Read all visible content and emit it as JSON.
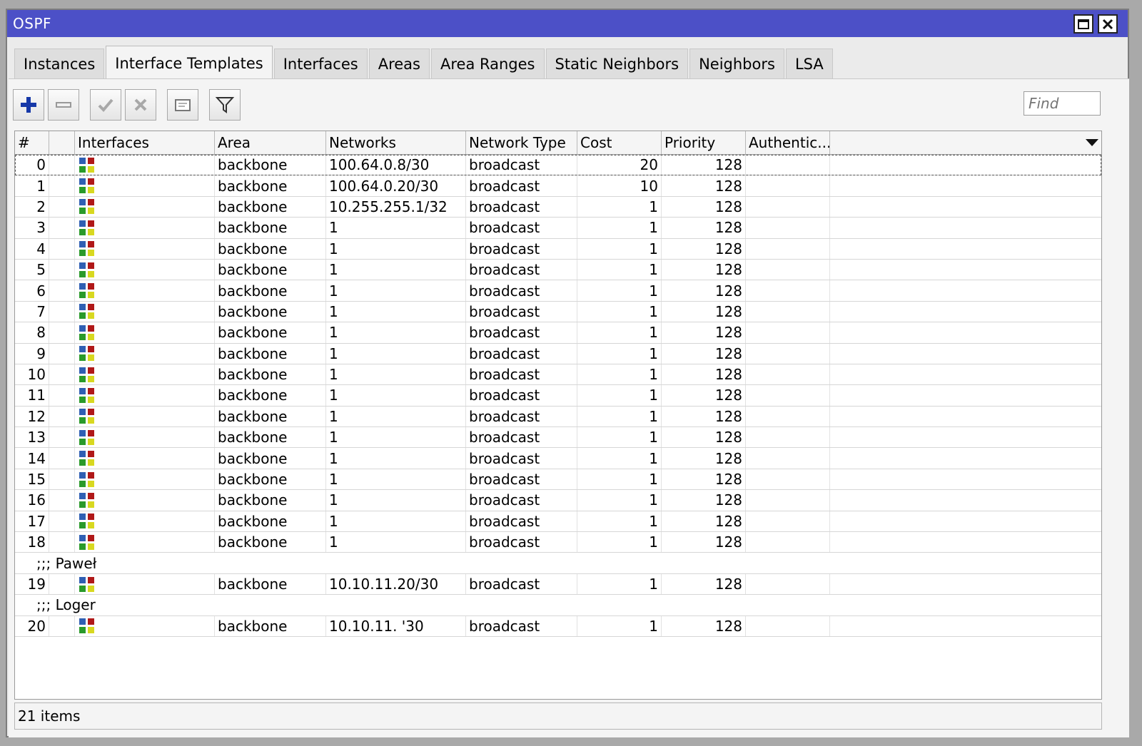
{
  "window": {
    "title": "OSPF"
  },
  "tabs": [
    {
      "label": "Instances",
      "active": false
    },
    {
      "label": "Interface Templates",
      "active": true
    },
    {
      "label": "Interfaces",
      "active": false
    },
    {
      "label": "Areas",
      "active": false
    },
    {
      "label": "Area Ranges",
      "active": false
    },
    {
      "label": "Static Neighbors",
      "active": false
    },
    {
      "label": "Neighbors",
      "active": false
    },
    {
      "label": "LSA",
      "active": false
    }
  ],
  "toolbar": {
    "buttons": [
      {
        "name": "add-button",
        "icon": "plus-icon"
      },
      {
        "name": "remove-button",
        "icon": "minus-icon"
      },
      {
        "name": "enable-button",
        "icon": "check-icon"
      },
      {
        "name": "disable-button",
        "icon": "cross-icon"
      },
      {
        "name": "comment-button",
        "icon": "note-icon"
      },
      {
        "name": "filter-button",
        "icon": "filter-icon"
      }
    ],
    "find_placeholder": "Find"
  },
  "table": {
    "columns": [
      "#",
      "",
      "Interfaces",
      "Area",
      "Networks",
      "Network Type",
      "Cost",
      "Priority",
      "Authentic..."
    ],
    "rows": [
      {
        "type": "data",
        "idx": "0",
        "area": "backbone",
        "network": "100.64.0.8/30",
        "ntype": "broadcast",
        "cost": "20",
        "priority": "128",
        "auth": ""
      },
      {
        "type": "data",
        "idx": "1",
        "area": "backbone",
        "network": "100.64.0.20/30",
        "ntype": "broadcast",
        "cost": "10",
        "priority": "128",
        "auth": ""
      },
      {
        "type": "data",
        "idx": "2",
        "area": "backbone",
        "network": "10.255.255.1/32",
        "ntype": "broadcast",
        "cost": "1",
        "priority": "128",
        "auth": ""
      },
      {
        "type": "data",
        "idx": "3",
        "area": "backbone",
        "network": "1",
        "ntype": "broadcast",
        "cost": "1",
        "priority": "128",
        "auth": ""
      },
      {
        "type": "data",
        "idx": "4",
        "area": "backbone",
        "network": "1",
        "ntype": "broadcast",
        "cost": "1",
        "priority": "128",
        "auth": ""
      },
      {
        "type": "data",
        "idx": "5",
        "area": "backbone",
        "network": "1",
        "ntype": "broadcast",
        "cost": "1",
        "priority": "128",
        "auth": ""
      },
      {
        "type": "data",
        "idx": "6",
        "area": "backbone",
        "network": "1",
        "ntype": "broadcast",
        "cost": "1",
        "priority": "128",
        "auth": ""
      },
      {
        "type": "data",
        "idx": "7",
        "area": "backbone",
        "network": "1",
        "ntype": "broadcast",
        "cost": "1",
        "priority": "128",
        "auth": ""
      },
      {
        "type": "data",
        "idx": "8",
        "area": "backbone",
        "network": "1",
        "ntype": "broadcast",
        "cost": "1",
        "priority": "128",
        "auth": ""
      },
      {
        "type": "data",
        "idx": "9",
        "area": "backbone",
        "network": "1",
        "ntype": "broadcast",
        "cost": "1",
        "priority": "128",
        "auth": ""
      },
      {
        "type": "data",
        "idx": "10",
        "area": "backbone",
        "network": "1",
        "ntype": "broadcast",
        "cost": "1",
        "priority": "128",
        "auth": ""
      },
      {
        "type": "data",
        "idx": "11",
        "area": "backbone",
        "network": "1",
        "ntype": "broadcast",
        "cost": "1",
        "priority": "128",
        "auth": ""
      },
      {
        "type": "data",
        "idx": "12",
        "area": "backbone",
        "network": "1",
        "ntype": "broadcast",
        "cost": "1",
        "priority": "128",
        "auth": ""
      },
      {
        "type": "data",
        "idx": "13",
        "area": "backbone",
        "network": "1",
        "ntype": "broadcast",
        "cost": "1",
        "priority": "128",
        "auth": ""
      },
      {
        "type": "data",
        "idx": "14",
        "area": "backbone",
        "network": "1",
        "ntype": "broadcast",
        "cost": "1",
        "priority": "128",
        "auth": ""
      },
      {
        "type": "data",
        "idx": "15",
        "area": "backbone",
        "network": "1",
        "ntype": "broadcast",
        "cost": "1",
        "priority": "128",
        "auth": ""
      },
      {
        "type": "data",
        "idx": "16",
        "area": "backbone",
        "network": "1",
        "ntype": "broadcast",
        "cost": "1",
        "priority": "128",
        "auth": ""
      },
      {
        "type": "data",
        "idx": "17",
        "area": "backbone",
        "network": "1",
        "ntype": "broadcast",
        "cost": "1",
        "priority": "128",
        "auth": ""
      },
      {
        "type": "data",
        "idx": "18",
        "area": "backbone",
        "network": "1",
        "ntype": "broadcast",
        "cost": "1",
        "priority": "128",
        "auth": ""
      },
      {
        "type": "comment",
        "text": ";;; Paweł"
      },
      {
        "type": "data",
        "idx": "19",
        "area": "backbone",
        "network": "10.10.11.20/30",
        "ntype": "broadcast",
        "cost": "1",
        "priority": "128",
        "auth": ""
      },
      {
        "type": "comment",
        "text": ";;; Loger"
      },
      {
        "type": "data",
        "idx": "20",
        "area": "backbone",
        "network": "10.10.11.      '30",
        "ntype": "broadcast",
        "cost": "1",
        "priority": "128",
        "auth": ""
      }
    ],
    "selected_index": 0
  },
  "status": {
    "items_text": "21 items"
  },
  "colors": {
    "titlebar": "#4c50c7",
    "icon_blue": "#2f5fb3",
    "icon_red": "#b01818",
    "icon_green": "#2a9a2a",
    "icon_yellow": "#d8d820"
  }
}
